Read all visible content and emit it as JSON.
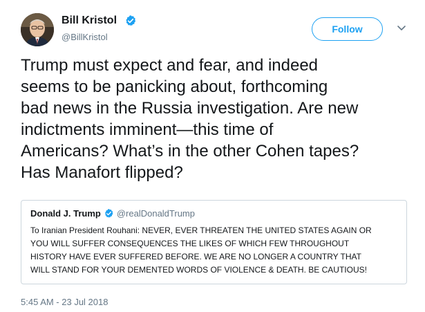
{
  "tweet": {
    "author": {
      "display_name": "Bill Kristol",
      "handle": "@BillKristol",
      "verified": true
    },
    "follow_label": "Follow",
    "text": "Trump must expect and fear, and indeed\nseems to be panicking about, forthcoming\nbad news in the Russia investigation. Are new\nindictments imminent—this time of\nAmericans? What’s in the other Cohen tapes?\nHas Manafort flipped?",
    "quoted_tweet": {
      "display_name": "Donald J. Trump",
      "handle": "@realDonaldTrump",
      "verified": true,
      "text": "To Iranian President Rouhani: NEVER, EVER THREATEN THE UNITED STATES AGAIN OR\nYOU WILL SUFFER CONSEQUENCES THE LIKES OF WHICH FEW THROUGHOUT\nHISTORY HAVE EVER SUFFERED BEFORE. WE ARE NO LONGER A COUNTRY THAT\nWILL STAND FOR YOUR DEMENTED WORDS OF VIOLENCE & DEATH. BE CAUTIOUS!"
    },
    "timestamp": "5:45 AM - 23 Jul 2018"
  },
  "icons": {
    "avatar": "avatar-photo",
    "verified": "verified-badge-icon",
    "menu": "chevron-down-icon"
  },
  "colors": {
    "brand_blue": "#1da1f2",
    "text_primary": "#14171a",
    "text_secondary": "#657786",
    "border": "#ccd6dd"
  }
}
